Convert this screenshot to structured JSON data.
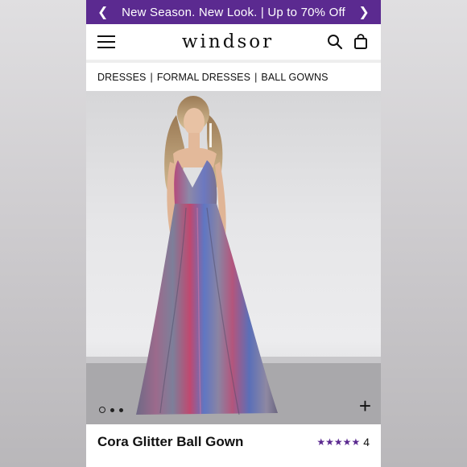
{
  "promo": {
    "prev_icon": "chevron-left-icon",
    "text": "New Season. New Look. | Up to 70% Off",
    "next_icon": "chevron-right-icon"
  },
  "header": {
    "logo": "windsor",
    "menu_icon": "hamburger-menu-icon",
    "search_icon": "search-icon",
    "bag_icon": "shopping-bag-icon"
  },
  "breadcrumb": [
    "DRESSES",
    "FORMAL DRESSES",
    "BALL GOWNS"
  ],
  "gallery": {
    "dot_count": 3,
    "active_dot": 0,
    "expand_icon": "plus-icon",
    "expand_label": "+"
  },
  "product": {
    "title": "Cora Glitter Ball Gown",
    "stars_display": "★★★★★",
    "rating": 5,
    "review_count": "4"
  },
  "colors": {
    "brand_purple": "#5b2a90",
    "star_purple": "#5b2a90"
  }
}
